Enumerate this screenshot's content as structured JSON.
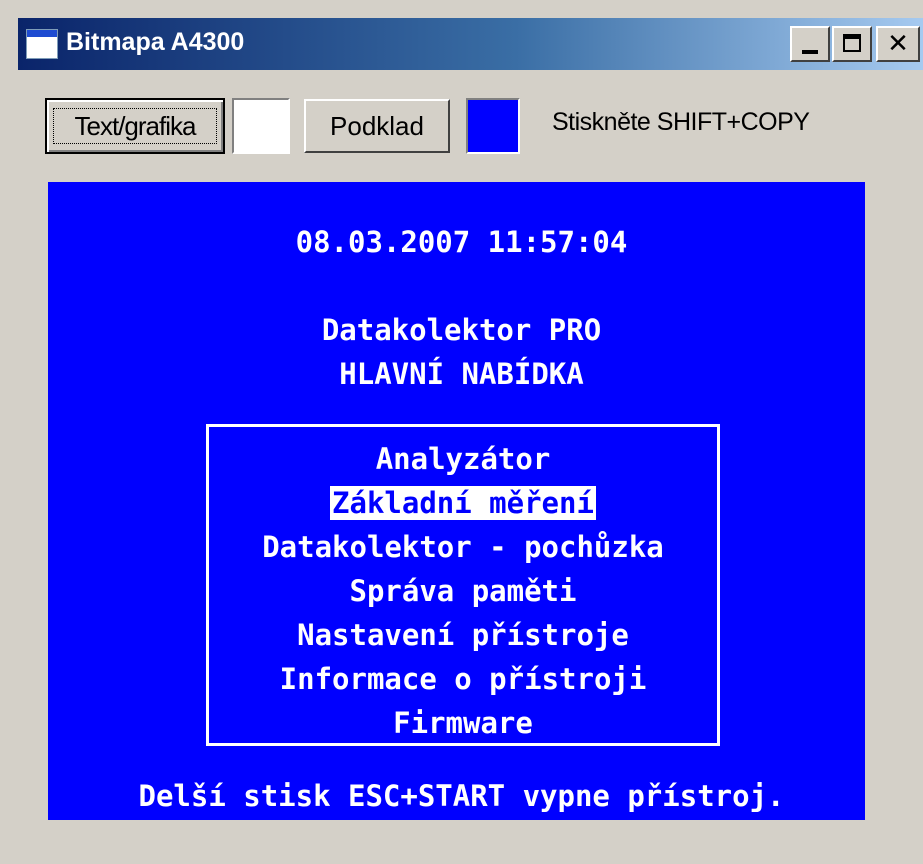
{
  "window": {
    "title": "Bitmapa A4300",
    "close_glyph": "✕"
  },
  "toolbar": {
    "text_graphics_label": "Text/grafika",
    "background_label": "Podklad",
    "hint": "Stiskněte SHIFT+COPY",
    "text_color": "#ffffff",
    "background_color": "#0000ff"
  },
  "screen": {
    "background_color": "#0000ff",
    "foreground_color": "#ffffff",
    "datetime": "08.03.2007 11:57:04",
    "product": "Datakolektor PRO",
    "heading": "HLAVNÍ NABÍDKA",
    "menu": [
      {
        "label": "Analyzátor",
        "selected": false
      },
      {
        "label": "Základní měření",
        "selected": true
      },
      {
        "label": "Datakolektor - pochůzka",
        "selected": false
      },
      {
        "label": "Správa paměti",
        "selected": false
      },
      {
        "label": "Nastavení přístroje",
        "selected": false
      },
      {
        "label": "Informace o přístroji",
        "selected": false
      },
      {
        "label": "Firmware",
        "selected": false
      }
    ],
    "footer": "Delší stisk ESC+START vypne přístroj."
  }
}
